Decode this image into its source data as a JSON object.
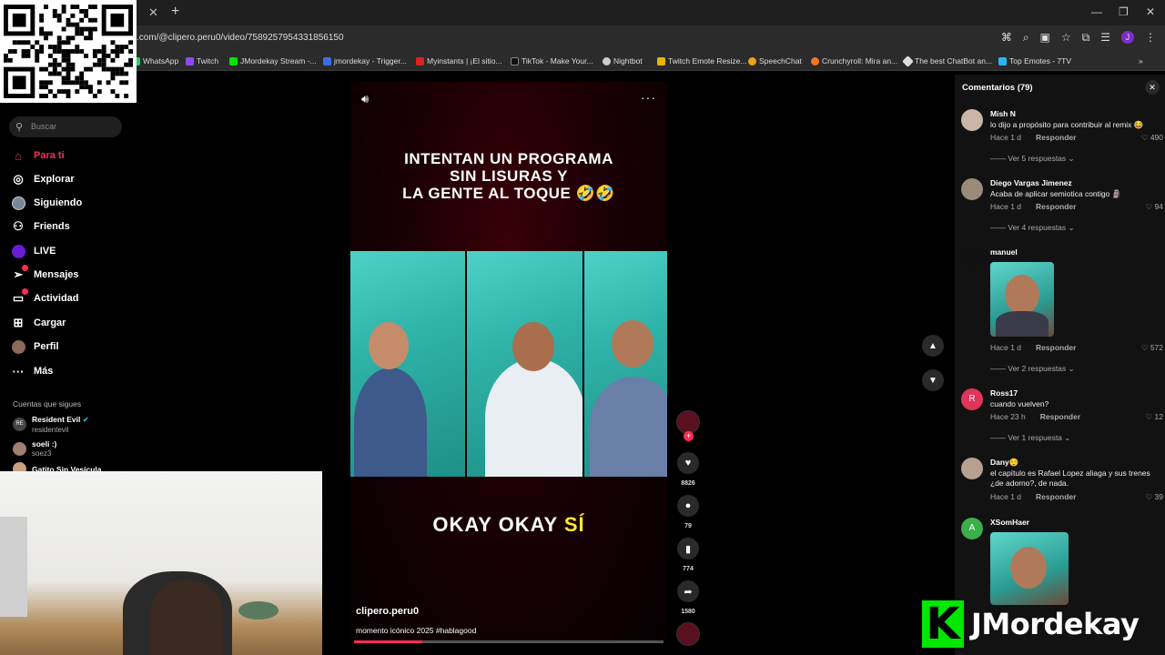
{
  "browser": {
    "url": ".com/@clipero.peru0/video/7589257954331856150",
    "bookmarks": [
      "WhatsApp",
      "Twitch",
      "JMordekay Stream -...",
      "jmordekay - Trigger...",
      "Myinstants | ¡El sitio...",
      "TikTok - Make Your...",
      "Nightbot",
      "Twitch Emote Resize...",
      "SpeechChat",
      "Crunchyroll: Mira an...",
      "The best ChatBot an...",
      "Top Emotes - 7TV"
    ],
    "profile_initial": "J"
  },
  "sidebar": {
    "search_placeholder": "Buscar",
    "nav": [
      "Para ti",
      "Explorar",
      "Siguiendo",
      "Friends",
      "LIVE",
      "Mensajes",
      "Actividad",
      "Cargar",
      "Perfil",
      "Más"
    ],
    "follows_title": "Cuentas que sigues",
    "follows": [
      {
        "name": "Resident Evil",
        "sub": "residentevil",
        "initials": "RE"
      },
      {
        "name": "soeli :)",
        "sub": "soez3",
        "initials": ""
      },
      {
        "name": "Gatito Sin Vesícula",
        "sub": "",
        "initials": ""
      }
    ]
  },
  "video": {
    "caption_lines": [
      "INTENTAN UN PROGRAMA",
      "SIN LISURAS Y",
      "LA GENTE AL TOQUE 🤣🤣"
    ],
    "subtitle_main": "OKAY OKAY ",
    "subtitle_hl": "SÍ",
    "author": "clipero.peru0",
    "description": "momento icónico 2025 #hablagood",
    "progress": 0.22,
    "likes": "8826",
    "comments": "79",
    "saves": "774",
    "shares": "1580"
  },
  "comments": {
    "title": "Comentarios (79)",
    "reply_label": "Responder",
    "items": [
      {
        "name": "Mish N",
        "text": "lo dijo a propósito para contribuir al remix 😂",
        "time": "Hace 1 d",
        "likes": "490",
        "more": "Ver 5 respuestas"
      },
      {
        "name": "Diego Vargas Jimenez",
        "text": "Acaba de aplicar semiotica contigo 🗿",
        "time": "Hace 1 d",
        "likes": "94",
        "more": "Ver 4 respuestas"
      },
      {
        "name": "manuel",
        "text": "",
        "time": "Hace 1 d",
        "likes": "572",
        "more": "Ver 2 respuestas"
      },
      {
        "name": "Ross17",
        "text": "cuando vuelven?",
        "time": "Hace 23 h",
        "likes": "12",
        "more": "Ver 1 respuesta",
        "initial": "R"
      },
      {
        "name": "Dany😌",
        "text": "el capítulo es Rafael Lopez aliaga y sus trenes ¿de adorno?, de nada.",
        "time": "Hace 1 d",
        "likes": "39",
        "more": ""
      },
      {
        "name": "XSomHaer",
        "text": "",
        "time": "",
        "likes": "",
        "more": "",
        "initial": "A"
      }
    ]
  },
  "overlay": {
    "logo_letter": "K",
    "logo_text": "JMordekay"
  },
  "colors": {
    "accent": "#fe2c55",
    "highlight": "#ffe833",
    "brand_green": "#00e701"
  }
}
